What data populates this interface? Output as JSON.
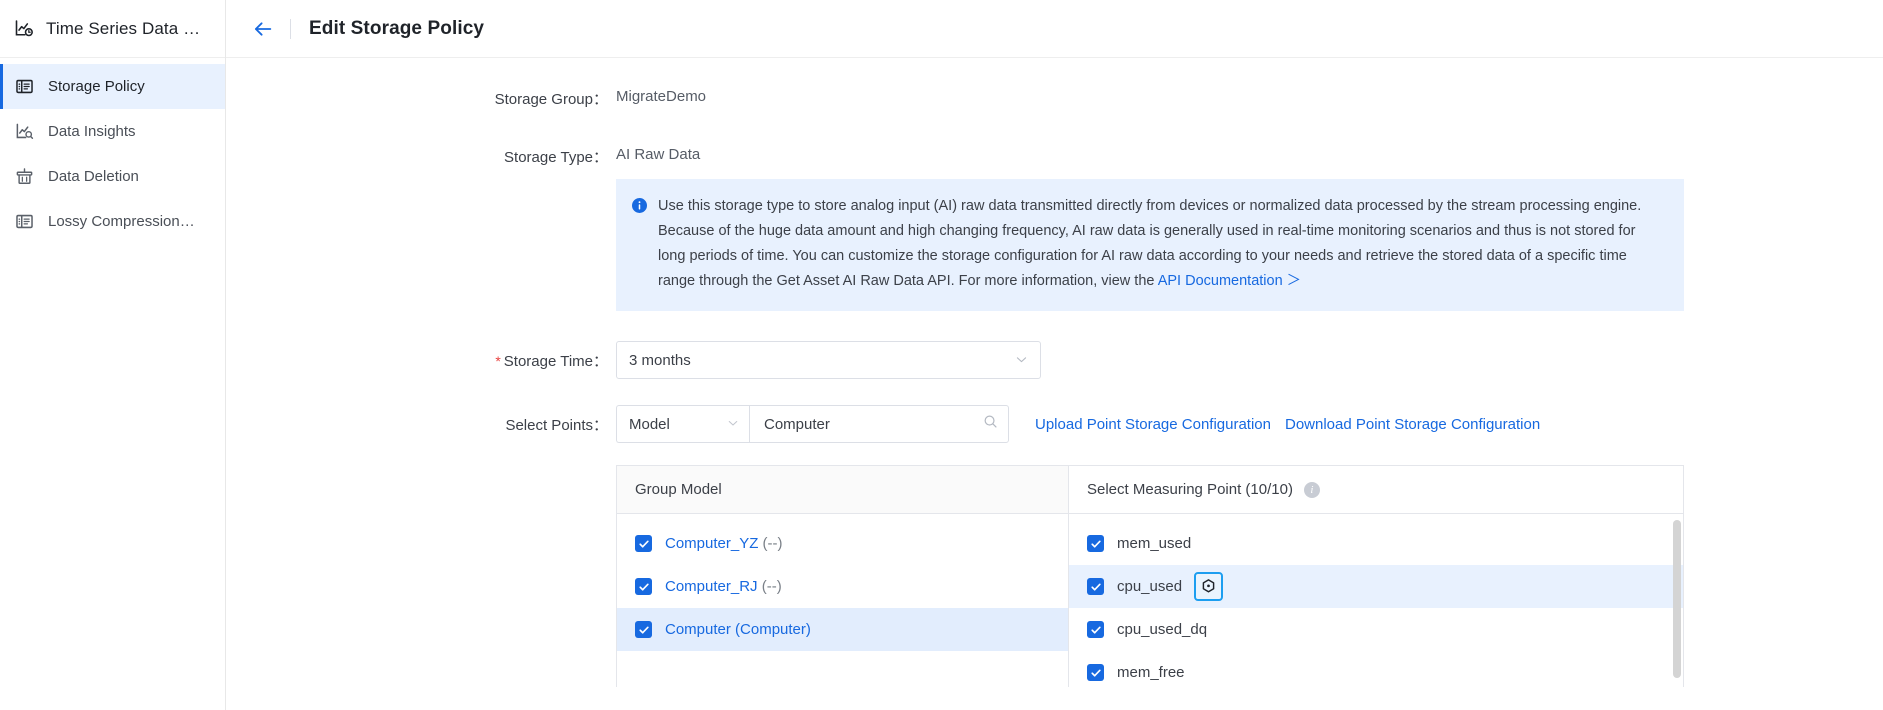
{
  "sidebar": {
    "brand": {
      "title": "Time Series Data …",
      "icon": "timeseries-chart-icon"
    },
    "items": [
      {
        "label": "Storage Policy",
        "icon": "list-panel-icon",
        "active": true
      },
      {
        "label": "Data Insights",
        "icon": "chart-search-icon",
        "active": false
      },
      {
        "label": "Data Deletion",
        "icon": "trash-broom-icon",
        "active": false
      },
      {
        "label": "Lossy Compression…",
        "icon": "list-panel-icon",
        "active": false
      }
    ]
  },
  "topbar": {
    "back_icon": "arrow-left-icon",
    "title": "Edit Storage Policy"
  },
  "form": {
    "storage_group": {
      "label": "Storage Group：",
      "value": "MigrateDemo"
    },
    "storage_type": {
      "label": "Storage Type：",
      "value": "AI Raw Data"
    },
    "banner": {
      "icon": "info-circle-icon",
      "text": "Use this storage type to store analog input (AI) raw data transmitted directly from devices or normalized data processed by the stream processing engine. Because of the huge data amount and high changing frequency, AI raw data is generally used in real-time monitoring scenarios and thus is not stored for long periods of time. You can customize the storage configuration for AI raw data according to your needs and retrieve the stored data of a specific time range through the Get Asset AI Raw Data API. For more information, view the ",
      "link_text": "API Documentation ＞"
    },
    "storage_time": {
      "label": "Storage Time：",
      "required": true,
      "value": "3 months",
      "chevron": "chevron-down-icon"
    },
    "select_points": {
      "label": "Select Points：",
      "mode": "Model",
      "mode_chevron": "chevron-down-icon",
      "search_value": "Computer",
      "search_placeholder": "",
      "search_icon": "search-icon",
      "upload_link": "Upload Point Storage Configuration",
      "download_link": "Download Point Storage Configuration"
    }
  },
  "table": {
    "header_left": "Group Model",
    "header_right": "Select Measuring Point (10/10)",
    "header_right_info_icon": "info-icon",
    "group_models": [
      {
        "name": "Computer_YZ",
        "suffix": "(--)",
        "checked": true,
        "selected": false
      },
      {
        "name": "Computer_RJ",
        "suffix": "(--)",
        "checked": true,
        "selected": false
      },
      {
        "name": "Computer",
        "suffix": "(Computer)",
        "checked": true,
        "selected": true
      }
    ],
    "measuring_points": [
      {
        "name": "mem_used",
        "checked": true,
        "highlighted": false,
        "has_config_button": false
      },
      {
        "name": "cpu_used",
        "checked": true,
        "highlighted": true,
        "has_config_button": true,
        "config_icon": "hexagon-settings-icon"
      },
      {
        "name": "cpu_used_dq",
        "checked": true,
        "highlighted": false,
        "has_config_button": false
      },
      {
        "name": "mem_free",
        "checked": true,
        "highlighted": false,
        "has_config_button": false
      }
    ],
    "scrollbar": "vertical-scrollbar"
  },
  "colors": {
    "accent": "#1769e0",
    "banner_bg": "#e8f1fe",
    "row_selected": "#e2edfd",
    "required_star": "#e8423f",
    "config_border": "#1c9ef0"
  }
}
